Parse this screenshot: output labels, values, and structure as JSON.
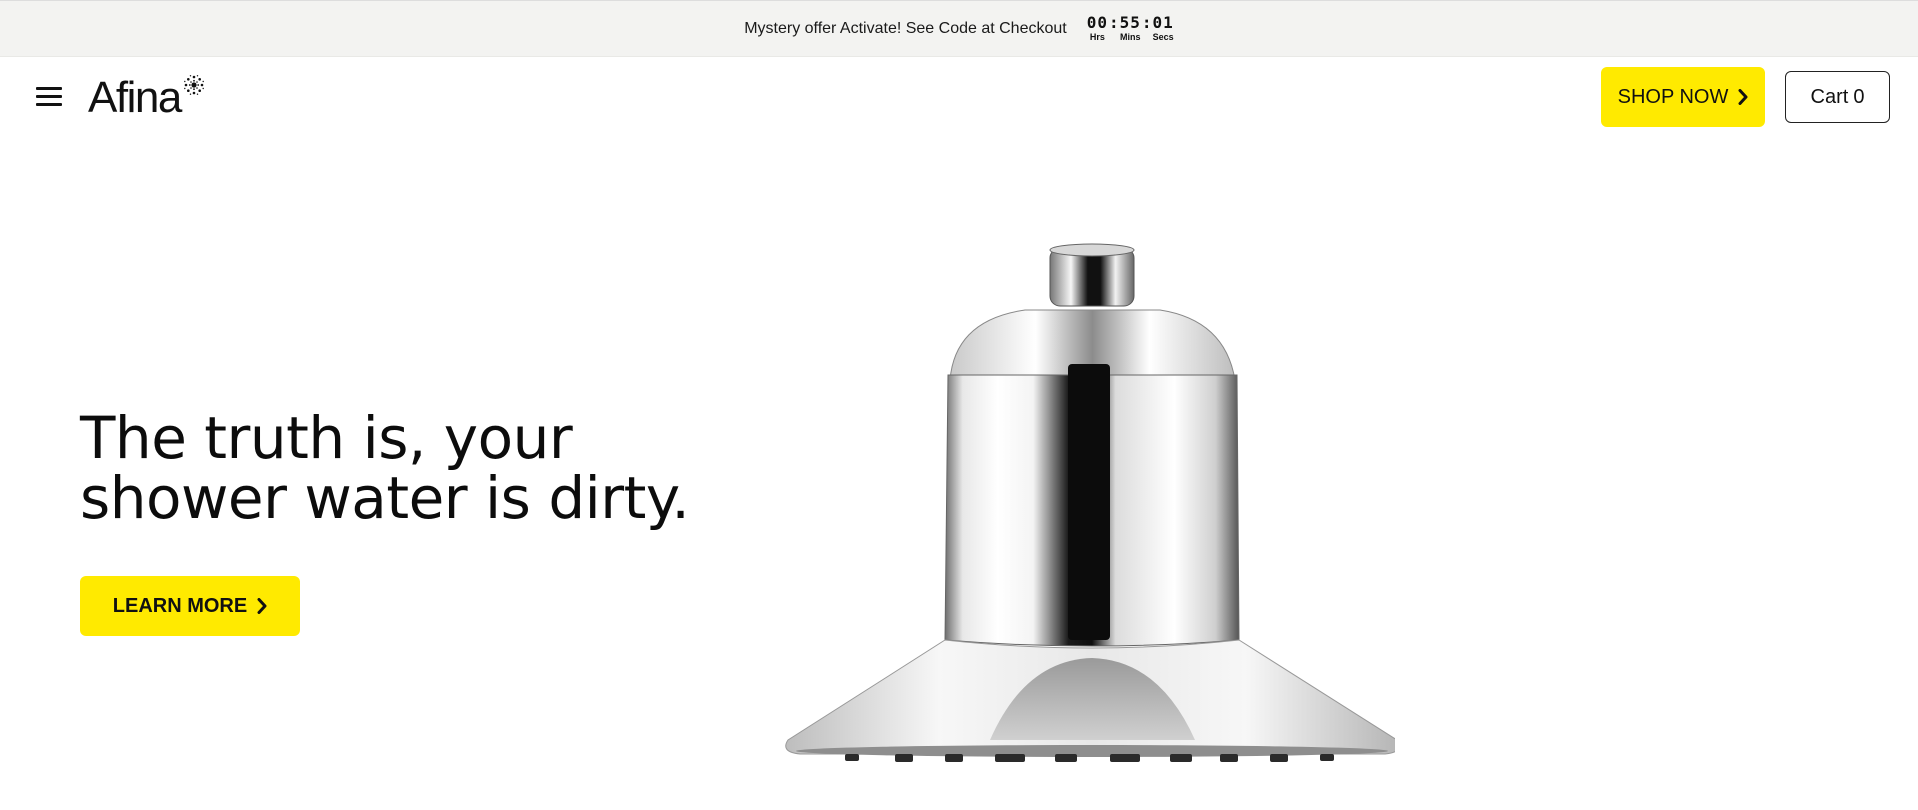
{
  "announcement": {
    "text": "Mystery offer Activate! See Code at Checkout",
    "timer": {
      "hours": "00",
      "minutes": "55",
      "seconds": "01",
      "hours_label": "Hrs",
      "minutes_label": "Mins",
      "seconds_label": "Secs",
      "separator": ":"
    }
  },
  "header": {
    "logo_text": "Afina",
    "shop_now_label": "SHOP NOW",
    "cart_label": "Cart",
    "cart_count": "0"
  },
  "hero": {
    "title": "The truth is, your shower water is dirty.",
    "learn_more_label": "LEARN MORE",
    "product_image": "chrome-shower-head"
  },
  "colors": {
    "accent_yellow": "#ffea00",
    "announcement_bg": "#f3f3f1",
    "text": "#111111"
  },
  "icons": {
    "menu": "hamburger-icon",
    "logo_mark": "sunburst-icon",
    "chevron": "chevron-right-icon"
  }
}
